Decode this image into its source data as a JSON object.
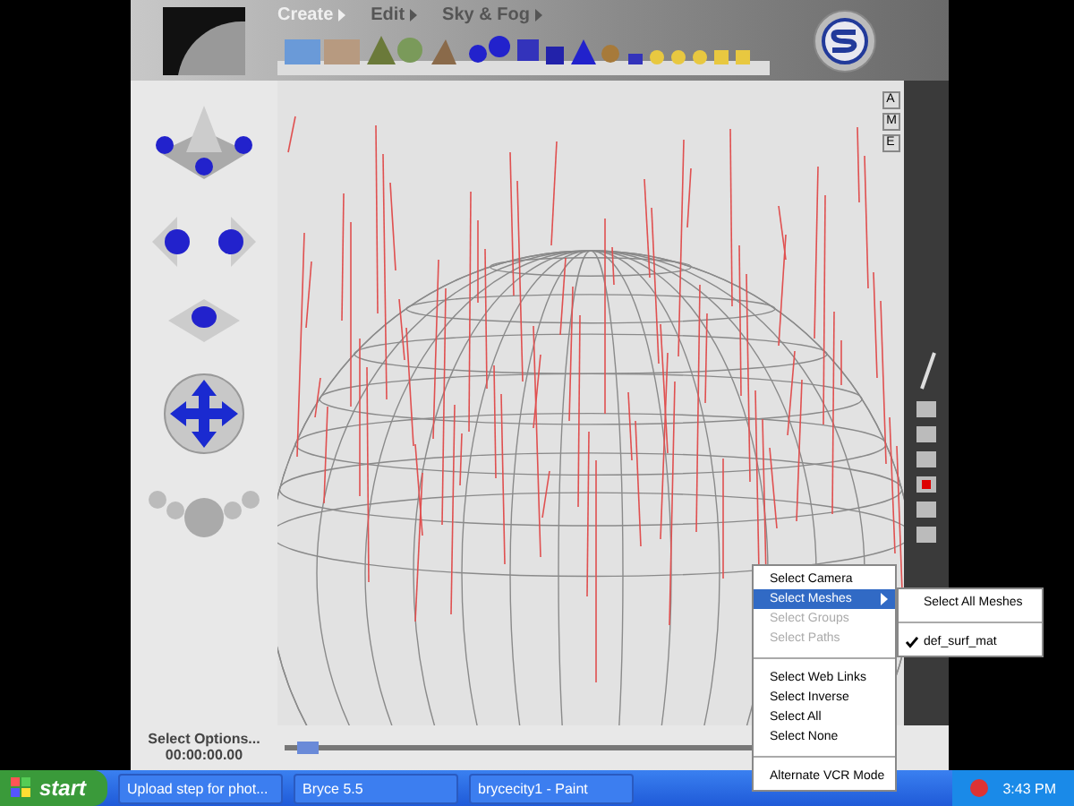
{
  "nav_menu": [
    {
      "label": "Create",
      "selected": true
    },
    {
      "label": "Edit",
      "selected": false
    },
    {
      "label": "Sky & Fog",
      "selected": false
    }
  ],
  "view_buttons": [
    "A",
    "M",
    "E"
  ],
  "status": {
    "label": "Select Options...",
    "time": "00:00:00.00"
  },
  "timeline": {
    "level": 0.02
  },
  "context_menu": {
    "items": [
      {
        "kind": "item",
        "label": "Select Camera",
        "disabled": false,
        "selected": false,
        "has_submenu": false
      },
      {
        "kind": "item",
        "label": "Select Meshes",
        "disabled": false,
        "selected": true,
        "has_submenu": true
      },
      {
        "kind": "item",
        "label": "Select Groups",
        "disabled": true,
        "selected": false,
        "has_submenu": false
      },
      {
        "kind": "item",
        "label": "Select Paths",
        "disabled": true,
        "selected": false,
        "has_submenu": false
      },
      {
        "kind": "separator"
      },
      {
        "kind": "item",
        "label": "Select Web Links",
        "disabled": false,
        "selected": false,
        "has_submenu": false
      },
      {
        "kind": "item",
        "label": "Select Inverse",
        "disabled": false,
        "selected": false,
        "has_submenu": false
      },
      {
        "kind": "item",
        "label": "Select All",
        "disabled": false,
        "selected": false,
        "has_submenu": false
      },
      {
        "kind": "item",
        "label": "Select None",
        "disabled": false,
        "selected": false,
        "has_submenu": false
      },
      {
        "kind": "separator"
      },
      {
        "kind": "item",
        "label": "Alternate VCR Mode",
        "disabled": false,
        "selected": false,
        "has_submenu": false
      }
    ],
    "submenu": [
      {
        "kind": "item",
        "label": "Select All Meshes",
        "checked": false
      },
      {
        "kind": "separator"
      },
      {
        "kind": "item",
        "label": "def_surf_mat",
        "checked": true
      }
    ]
  },
  "taskbar": {
    "start": "start",
    "tasks": [
      "Upload step for phot...",
      "Bryce 5.5",
      "brycecity1 - Paint"
    ],
    "clock": "3:43 PM"
  }
}
